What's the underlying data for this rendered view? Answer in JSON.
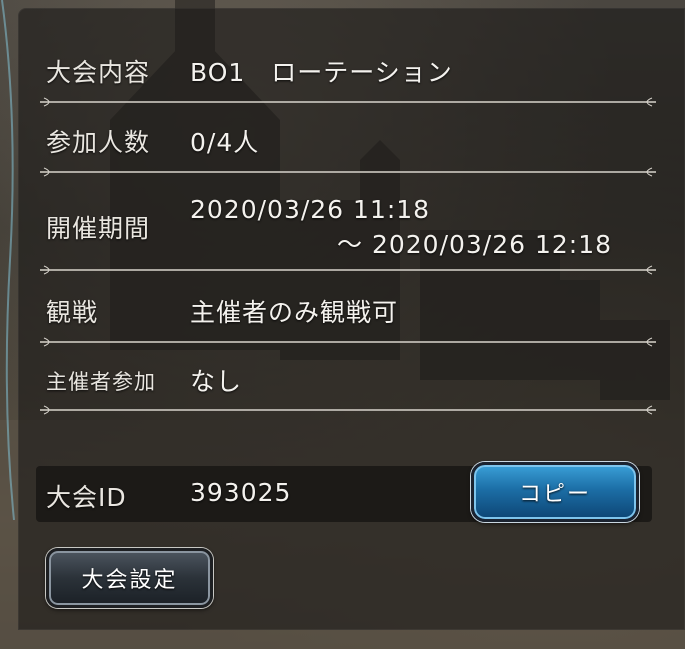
{
  "rows": {
    "format": {
      "label": "大会内容",
      "value": "BO1　ローテーション"
    },
    "participants": {
      "label": "参加人数",
      "value": "0/4人"
    },
    "period": {
      "label": "開催期間",
      "start": "2020/03/26 11:18",
      "end": "～ 2020/03/26 12:18"
    },
    "spectate": {
      "label": "観戦",
      "value": "主催者のみ観戦可"
    },
    "host_participation": {
      "label": "主催者参加",
      "value": "なし"
    }
  },
  "tournament_id": {
    "label": "大会ID",
    "value": "393025"
  },
  "buttons": {
    "copy_label": "コピー",
    "settings_label": "大会設定"
  },
  "colors": {
    "text": "#f4f2ee",
    "copy_button": "#1c6ea6",
    "settings_button": "#2b3239"
  }
}
